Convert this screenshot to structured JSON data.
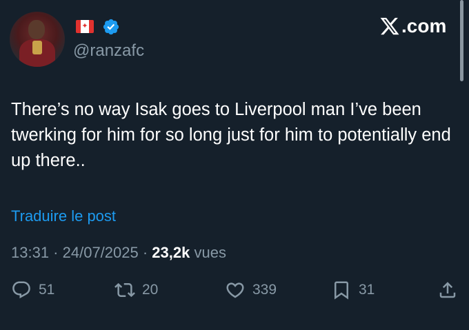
{
  "author": {
    "handle": "@ranzafc",
    "flag_icon": "canada-flag-icon",
    "verified_icon": "verified-badge-icon"
  },
  "brand": {
    "label": ".com",
    "logo_icon": "x-logo-icon"
  },
  "tweet": {
    "text": "There’s no way Isak goes to Liverpool man I’ve been twerking for him for so long just for him to potentially end up there.."
  },
  "translate": {
    "label": "Traduire le post"
  },
  "meta": {
    "time": "13:31",
    "separator": " · ",
    "date": "24/07/2025",
    "views_count": "23,2k",
    "views_label": " vues"
  },
  "actions": {
    "replies": "51",
    "reposts": "20",
    "likes": "339",
    "bookmarks": "31"
  },
  "colors": {
    "background": "#15202b",
    "text": "#ffffff",
    "secondary": "#8899a6",
    "accent": "#1d9bf0"
  }
}
